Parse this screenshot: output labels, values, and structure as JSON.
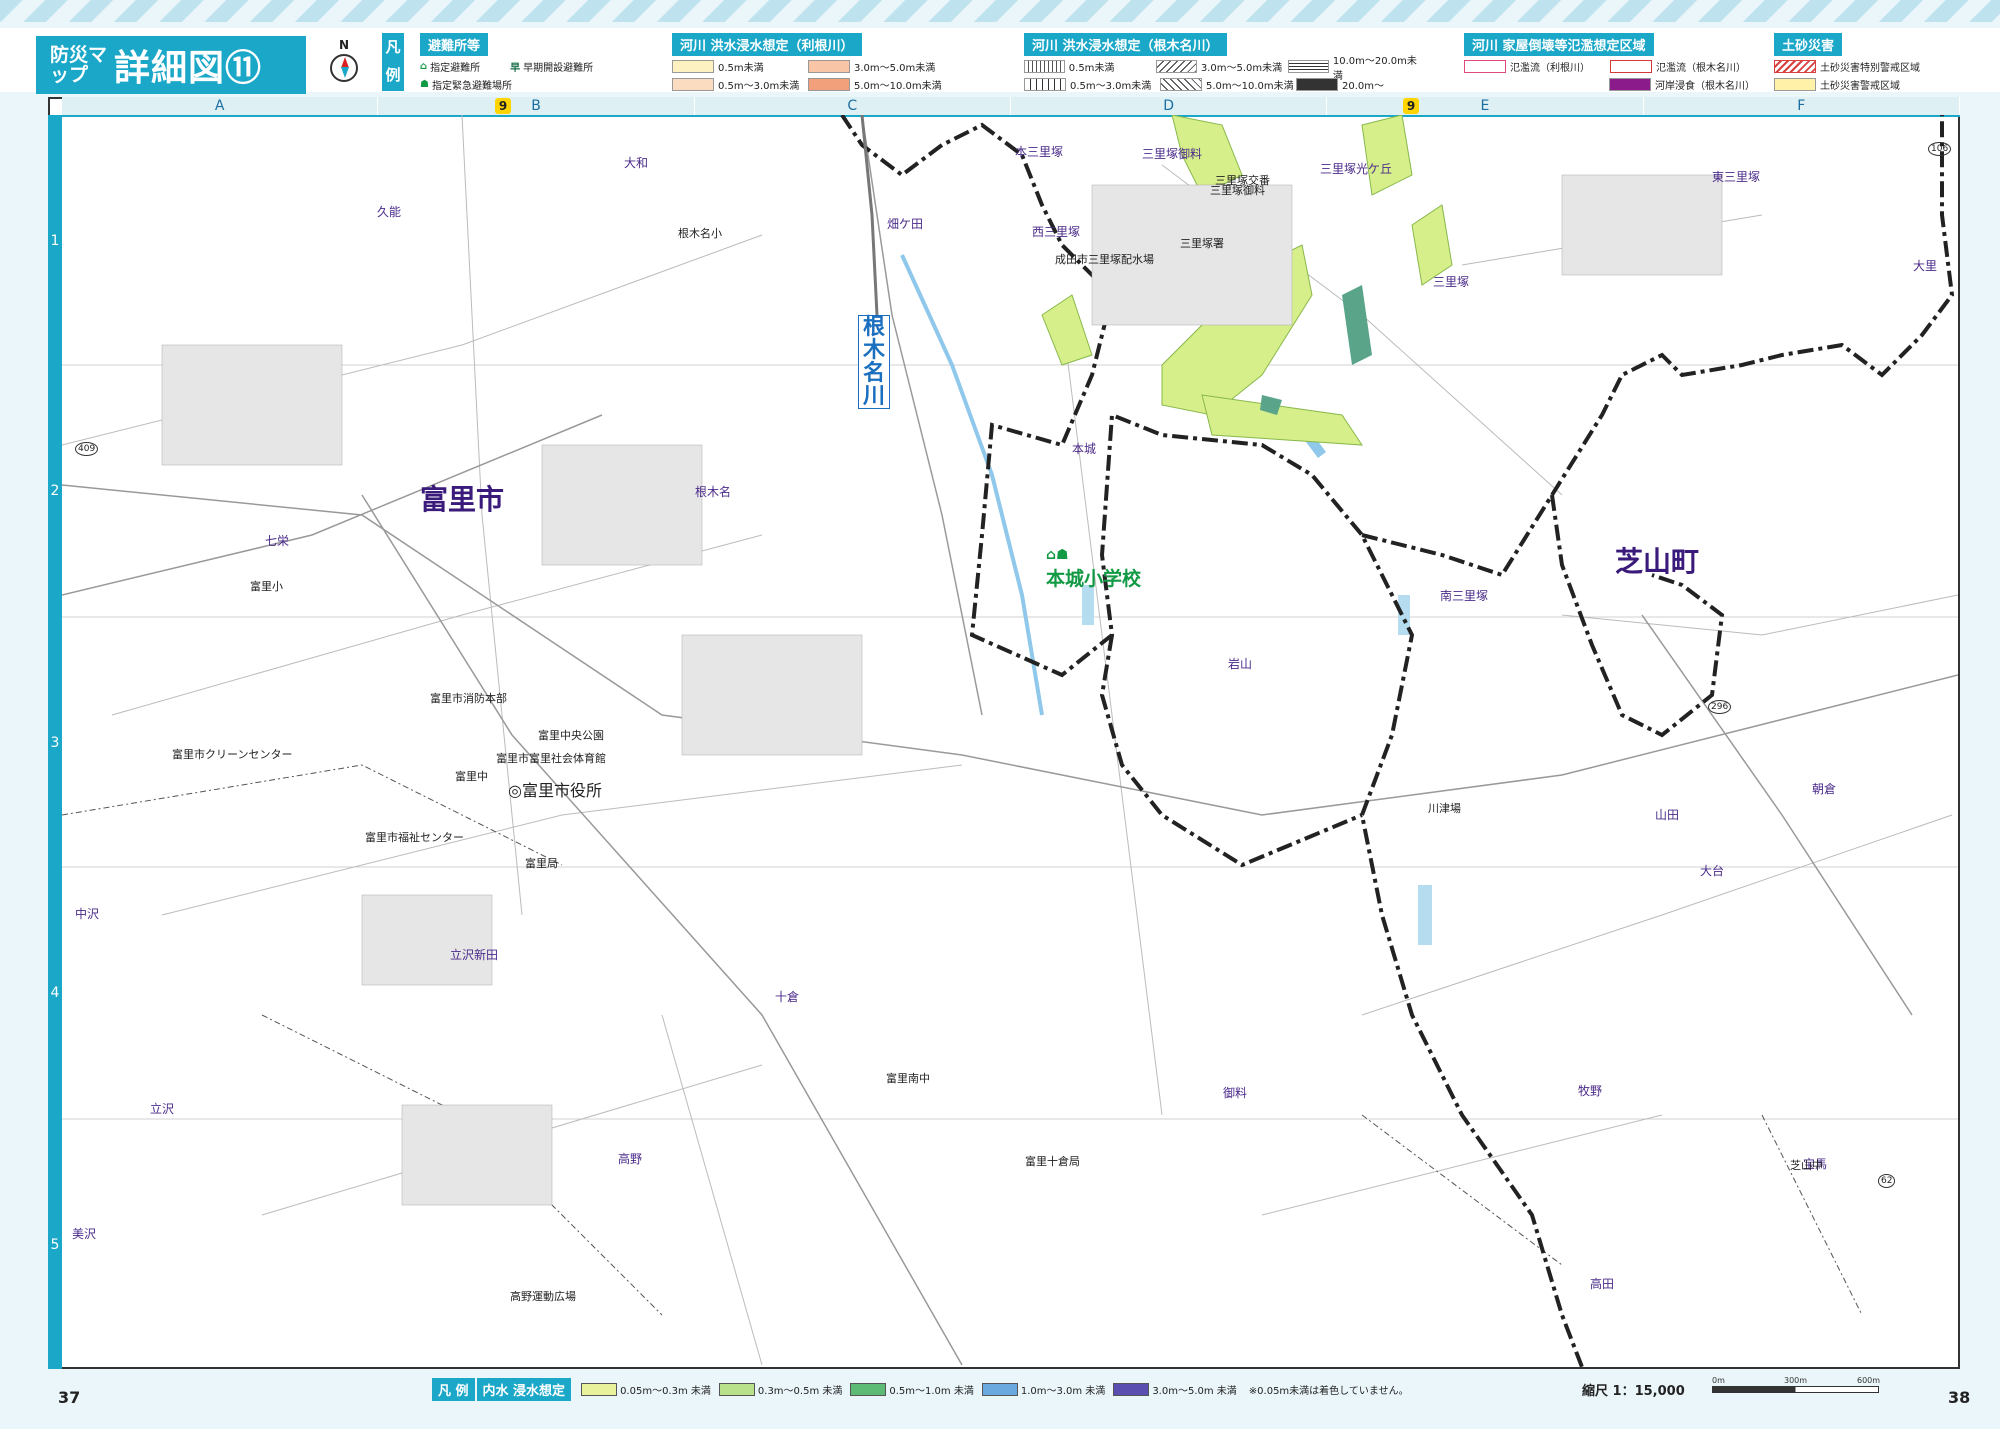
{
  "header": {
    "title_small": "防災マップ",
    "title_big": "詳細図⑪",
    "north": "N",
    "legend_tag": "凡例"
  },
  "legend": {
    "shelter": {
      "heading": "避難所等",
      "items": [
        "指定避難所",
        "早期開設避難所",
        "指定緊急避難場所"
      ]
    },
    "tone": {
      "heading": "河川 洪水浸水想定（利根川）",
      "items": [
        {
          "label": "0.5m未満",
          "color": "#fdf1c2"
        },
        {
          "label": "3.0m～5.0m未満",
          "color": "#f8c6a6"
        },
        {
          "label": "0.5m～3.0m未満",
          "color": "#fbdcc0"
        },
        {
          "label": "5.0m～10.0m未満",
          "color": "#f2a07b"
        }
      ]
    },
    "negi": {
      "heading": "河川 洪水浸水想定（根木名川）",
      "items": [
        "0.5m未満",
        "3.0m～5.0m未満",
        "10.0m～20.0m未満",
        "0.5m～3.0m未満",
        "5.0m～10.0m未満",
        "20.0m～"
      ]
    },
    "house": {
      "heading": "河川 家屋倒壊等氾濫想定区域",
      "items": [
        {
          "label": "氾濫流（利根川）",
          "color": "#e04a7a"
        },
        {
          "label": "氾濫流（根木名川）",
          "color": "#d23a3a"
        },
        {
          "label": "河岸浸食（根木名川）",
          "color": "#8b1a8b"
        }
      ]
    },
    "sediment": {
      "heading": "土砂災害",
      "items": [
        {
          "label": "土砂災害特別警戒区域",
          "color": "#d84040"
        },
        {
          "label": "土砂災害警戒区域",
          "color": "#fff2a8"
        }
      ]
    }
  },
  "grid": {
    "columns": [
      "A",
      "B",
      "C",
      "D",
      "E",
      "F"
    ],
    "rows": [
      "1",
      "2",
      "3",
      "4",
      "5"
    ],
    "badge": "9"
  },
  "map": {
    "city_labels": [
      "富里市",
      "芝山町"
    ],
    "river_label": "根木名川",
    "school_label": "本城小学校",
    "places": [
      "大和",
      "久能",
      "根木名",
      "七栄",
      "中沢",
      "立沢新田",
      "立沢",
      "美沢",
      "十倉",
      "高野",
      "本三里塚",
      "三里塚御料",
      "三里塚光ケ丘",
      "東三里塚",
      "大里",
      "畑ケ田",
      "西三里塚",
      "三里塚",
      "本城",
      "南三里塚",
      "岩山",
      "山田",
      "大台",
      "朝倉",
      "御料",
      "牧野",
      "宝馬",
      "高田"
    ],
    "pois": [
      "根木名小",
      "三里塚交番",
      "三里塚御料",
      "三里塚署",
      "成田市三里塚配水場",
      "富里小",
      "富里市消防本部",
      "富里中央公園",
      "富里市クリーンセンター",
      "富里市富里社会体育館",
      "富里中",
      "◎富里市役所",
      "富里市福祉センター",
      "富里局",
      "富里南中",
      "富里十倉局",
      "高野運動広場",
      "芝山中",
      "川津場"
    ],
    "route_labels": [
      "106",
      "409",
      "296",
      "62"
    ]
  },
  "footer": {
    "page_left": "37",
    "page_right": "38",
    "legend_tag": "凡 例",
    "inner_tag": "内水 浸水想定",
    "items": [
      {
        "label": "0.05m～0.3m 未満",
        "color": "#e8f29a"
      },
      {
        "label": "0.3m～0.5m 未満",
        "color": "#b9e08a"
      },
      {
        "label": "0.5m～1.0m 未満",
        "color": "#5dbb75"
      },
      {
        "label": "1.0m～3.0m 未満",
        "color": "#6aa9e0"
      },
      {
        "label": "3.0m～5.0m 未満",
        "color": "#5a4fb0"
      }
    ],
    "note": "※0.05m未満は着色していません。",
    "scale_label": "縮尺 1：15,000",
    "scale_ticks": [
      "0m",
      "300m",
      "600m"
    ]
  }
}
